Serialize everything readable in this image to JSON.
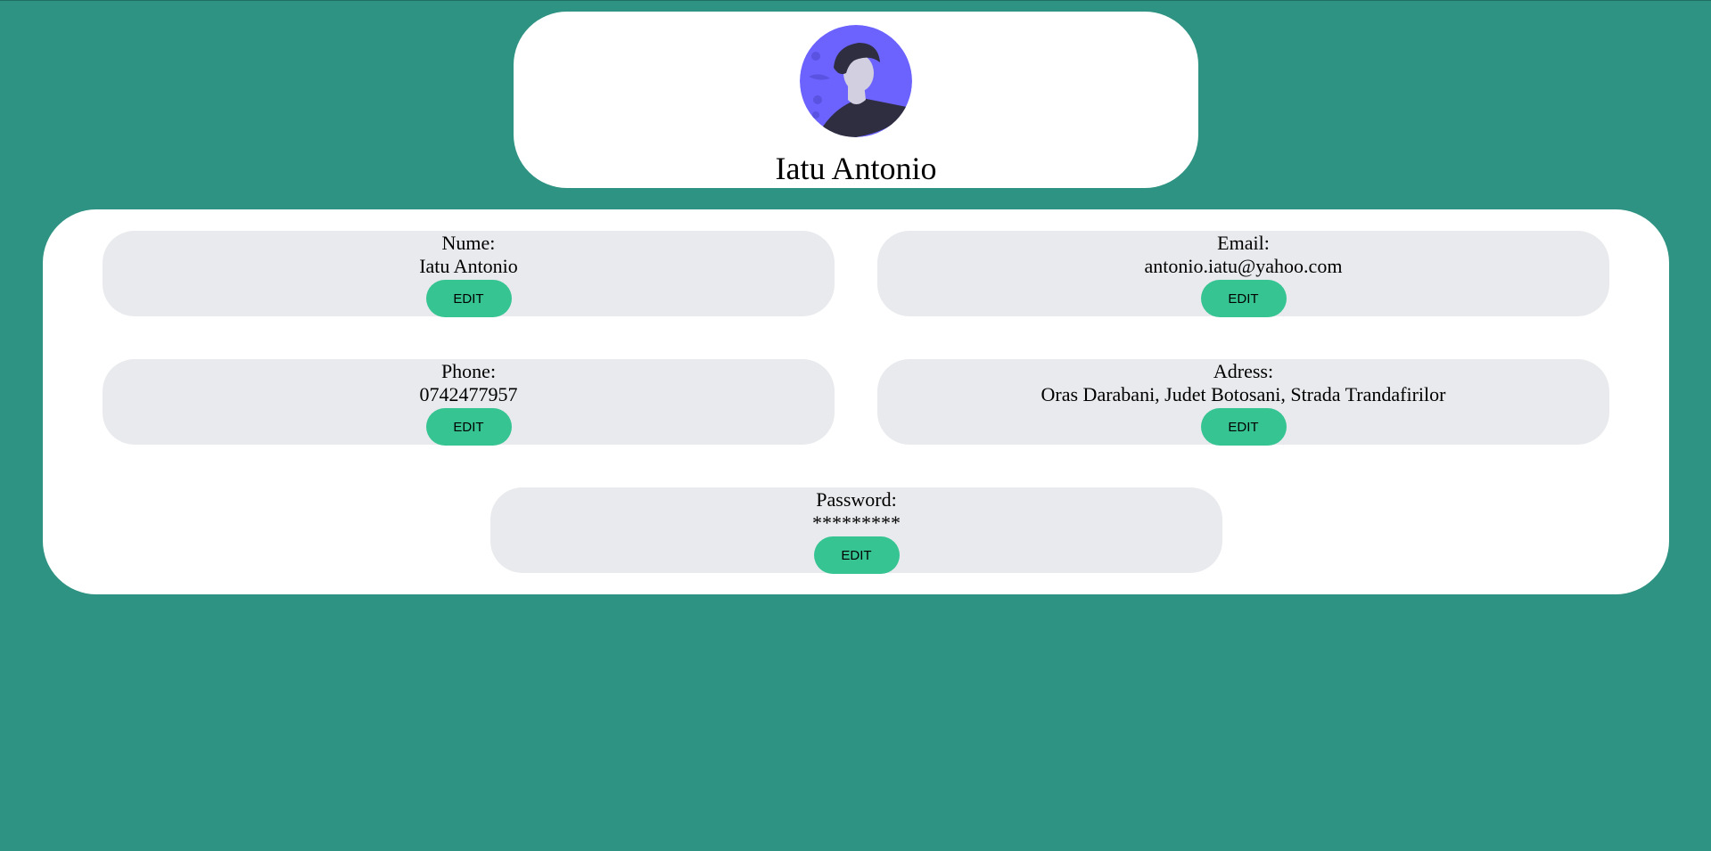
{
  "colors": {
    "background": "#2e9383",
    "card": "#ffffff",
    "field_background": "#e9eaed",
    "edit_button": "#36c493",
    "avatar_circle": "#6c63ff"
  },
  "profile": {
    "avatar_icon": "user-avatar-icon",
    "name": "Iatu Antonio"
  },
  "fields": {
    "nume": {
      "label": "Nume:",
      "value": "Iatu Antonio",
      "edit_label": "EDIT"
    },
    "email": {
      "label": "Email:",
      "value": "antonio.iatu@yahoo.com",
      "edit_label": "EDIT"
    },
    "phone": {
      "label": "Phone:",
      "value": "0742477957",
      "edit_label": "EDIT"
    },
    "adress": {
      "label": "Adress:",
      "value": "Oras Darabani, Judet Botosani, Strada Trandafirilor",
      "edit_label": "EDIT"
    },
    "password": {
      "label": "Password:",
      "value": "*********",
      "edit_label": "EDIT"
    }
  }
}
